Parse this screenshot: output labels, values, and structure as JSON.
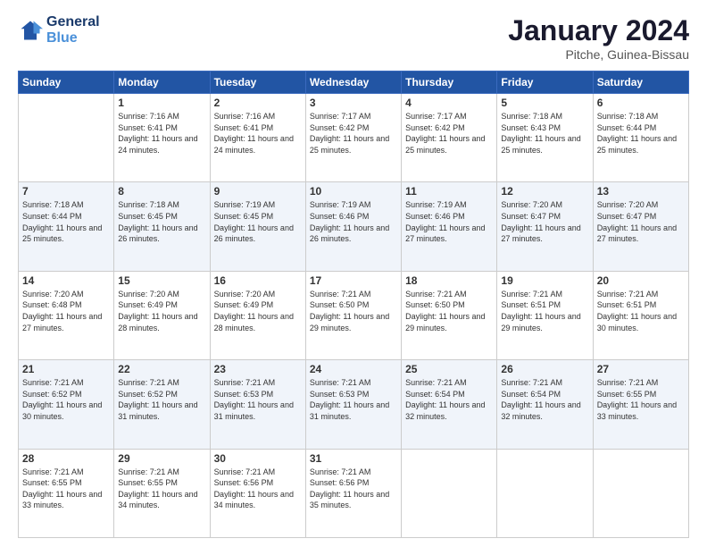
{
  "header": {
    "logo_line1": "General",
    "logo_line2": "Blue",
    "month_title": "January 2024",
    "location": "Pitche, Guinea-Bissau"
  },
  "days_of_week": [
    "Sunday",
    "Monday",
    "Tuesday",
    "Wednesday",
    "Thursday",
    "Friday",
    "Saturday"
  ],
  "weeks": [
    [
      {
        "day": "",
        "sunrise": "",
        "sunset": "",
        "daylight": ""
      },
      {
        "day": "1",
        "sunrise": "Sunrise: 7:16 AM",
        "sunset": "Sunset: 6:41 PM",
        "daylight": "Daylight: 11 hours and 24 minutes."
      },
      {
        "day": "2",
        "sunrise": "Sunrise: 7:16 AM",
        "sunset": "Sunset: 6:41 PM",
        "daylight": "Daylight: 11 hours and 24 minutes."
      },
      {
        "day": "3",
        "sunrise": "Sunrise: 7:17 AM",
        "sunset": "Sunset: 6:42 PM",
        "daylight": "Daylight: 11 hours and 25 minutes."
      },
      {
        "day": "4",
        "sunrise": "Sunrise: 7:17 AM",
        "sunset": "Sunset: 6:42 PM",
        "daylight": "Daylight: 11 hours and 25 minutes."
      },
      {
        "day": "5",
        "sunrise": "Sunrise: 7:18 AM",
        "sunset": "Sunset: 6:43 PM",
        "daylight": "Daylight: 11 hours and 25 minutes."
      },
      {
        "day": "6",
        "sunrise": "Sunrise: 7:18 AM",
        "sunset": "Sunset: 6:44 PM",
        "daylight": "Daylight: 11 hours and 25 minutes."
      }
    ],
    [
      {
        "day": "7",
        "sunrise": "Sunrise: 7:18 AM",
        "sunset": "Sunset: 6:44 PM",
        "daylight": "Daylight: 11 hours and 25 minutes."
      },
      {
        "day": "8",
        "sunrise": "Sunrise: 7:18 AM",
        "sunset": "Sunset: 6:45 PM",
        "daylight": "Daylight: 11 hours and 26 minutes."
      },
      {
        "day": "9",
        "sunrise": "Sunrise: 7:19 AM",
        "sunset": "Sunset: 6:45 PM",
        "daylight": "Daylight: 11 hours and 26 minutes."
      },
      {
        "day": "10",
        "sunrise": "Sunrise: 7:19 AM",
        "sunset": "Sunset: 6:46 PM",
        "daylight": "Daylight: 11 hours and 26 minutes."
      },
      {
        "day": "11",
        "sunrise": "Sunrise: 7:19 AM",
        "sunset": "Sunset: 6:46 PM",
        "daylight": "Daylight: 11 hours and 27 minutes."
      },
      {
        "day": "12",
        "sunrise": "Sunrise: 7:20 AM",
        "sunset": "Sunset: 6:47 PM",
        "daylight": "Daylight: 11 hours and 27 minutes."
      },
      {
        "day": "13",
        "sunrise": "Sunrise: 7:20 AM",
        "sunset": "Sunset: 6:47 PM",
        "daylight": "Daylight: 11 hours and 27 minutes."
      }
    ],
    [
      {
        "day": "14",
        "sunrise": "Sunrise: 7:20 AM",
        "sunset": "Sunset: 6:48 PM",
        "daylight": "Daylight: 11 hours and 27 minutes."
      },
      {
        "day": "15",
        "sunrise": "Sunrise: 7:20 AM",
        "sunset": "Sunset: 6:49 PM",
        "daylight": "Daylight: 11 hours and 28 minutes."
      },
      {
        "day": "16",
        "sunrise": "Sunrise: 7:20 AM",
        "sunset": "Sunset: 6:49 PM",
        "daylight": "Daylight: 11 hours and 28 minutes."
      },
      {
        "day": "17",
        "sunrise": "Sunrise: 7:21 AM",
        "sunset": "Sunset: 6:50 PM",
        "daylight": "Daylight: 11 hours and 29 minutes."
      },
      {
        "day": "18",
        "sunrise": "Sunrise: 7:21 AM",
        "sunset": "Sunset: 6:50 PM",
        "daylight": "Daylight: 11 hours and 29 minutes."
      },
      {
        "day": "19",
        "sunrise": "Sunrise: 7:21 AM",
        "sunset": "Sunset: 6:51 PM",
        "daylight": "Daylight: 11 hours and 29 minutes."
      },
      {
        "day": "20",
        "sunrise": "Sunrise: 7:21 AM",
        "sunset": "Sunset: 6:51 PM",
        "daylight": "Daylight: 11 hours and 30 minutes."
      }
    ],
    [
      {
        "day": "21",
        "sunrise": "Sunrise: 7:21 AM",
        "sunset": "Sunset: 6:52 PM",
        "daylight": "Daylight: 11 hours and 30 minutes."
      },
      {
        "day": "22",
        "sunrise": "Sunrise: 7:21 AM",
        "sunset": "Sunset: 6:52 PM",
        "daylight": "Daylight: 11 hours and 31 minutes."
      },
      {
        "day": "23",
        "sunrise": "Sunrise: 7:21 AM",
        "sunset": "Sunset: 6:53 PM",
        "daylight": "Daylight: 11 hours and 31 minutes."
      },
      {
        "day": "24",
        "sunrise": "Sunrise: 7:21 AM",
        "sunset": "Sunset: 6:53 PM",
        "daylight": "Daylight: 11 hours and 31 minutes."
      },
      {
        "day": "25",
        "sunrise": "Sunrise: 7:21 AM",
        "sunset": "Sunset: 6:54 PM",
        "daylight": "Daylight: 11 hours and 32 minutes."
      },
      {
        "day": "26",
        "sunrise": "Sunrise: 7:21 AM",
        "sunset": "Sunset: 6:54 PM",
        "daylight": "Daylight: 11 hours and 32 minutes."
      },
      {
        "day": "27",
        "sunrise": "Sunrise: 7:21 AM",
        "sunset": "Sunset: 6:55 PM",
        "daylight": "Daylight: 11 hours and 33 minutes."
      }
    ],
    [
      {
        "day": "28",
        "sunrise": "Sunrise: 7:21 AM",
        "sunset": "Sunset: 6:55 PM",
        "daylight": "Daylight: 11 hours and 33 minutes."
      },
      {
        "day": "29",
        "sunrise": "Sunrise: 7:21 AM",
        "sunset": "Sunset: 6:55 PM",
        "daylight": "Daylight: 11 hours and 34 minutes."
      },
      {
        "day": "30",
        "sunrise": "Sunrise: 7:21 AM",
        "sunset": "Sunset: 6:56 PM",
        "daylight": "Daylight: 11 hours and 34 minutes."
      },
      {
        "day": "31",
        "sunrise": "Sunrise: 7:21 AM",
        "sunset": "Sunset: 6:56 PM",
        "daylight": "Daylight: 11 hours and 35 minutes."
      },
      {
        "day": "",
        "sunrise": "",
        "sunset": "",
        "daylight": ""
      },
      {
        "day": "",
        "sunrise": "",
        "sunset": "",
        "daylight": ""
      },
      {
        "day": "",
        "sunrise": "",
        "sunset": "",
        "daylight": ""
      }
    ]
  ]
}
